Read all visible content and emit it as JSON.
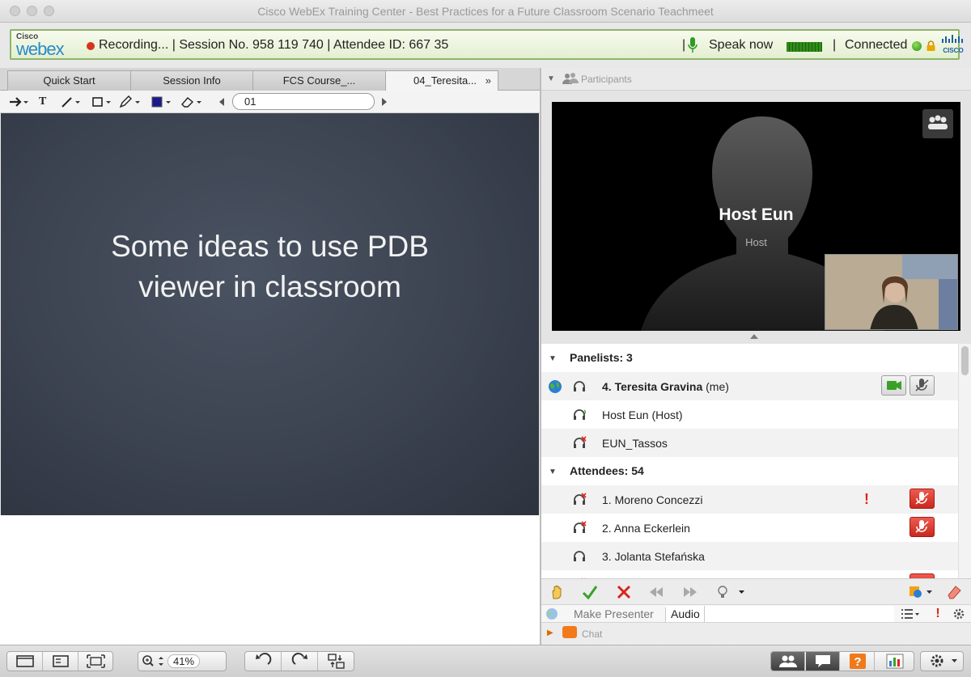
{
  "window": {
    "title": "Cisco WebEx Training Center - Best Practices for a Future Classroom Scenario Teachmeet"
  },
  "banner": {
    "logo_small": "Cisco",
    "logo_large": "webex",
    "status": "Recording... | Session No. 958 119 740 | Attendee ID: 667 35",
    "divider_1": "|",
    "speak": "Speak now",
    "divider_2": "|",
    "connected": "Connected",
    "cisco_text": "CISCO"
  },
  "tabs": [
    {
      "label": "Quick Start"
    },
    {
      "label": "Session Info"
    },
    {
      "label": "FCS Course_..."
    },
    {
      "label": "04_Teresita...",
      "more": "»"
    }
  ],
  "toolbar": {
    "pointer_icon": "arrow-pointer-icon",
    "text_icon": "T",
    "page": "01"
  },
  "slide": {
    "line1": "Some ideas to use PDB",
    "line2": "viewer in classroom"
  },
  "participants_panel": {
    "header": "Participants",
    "video": {
      "name": "Host Eun",
      "role": "Host"
    },
    "panelists": {
      "header": "Panelists: 3",
      "items": [
        {
          "number": "4. Teresita Gravina",
          "suffix": "(me)"
        },
        {
          "name": "Host Eun (Host)"
        },
        {
          "name": "EUN_Tassos"
        }
      ]
    },
    "attendees": {
      "header": "Attendees: 54",
      "items": [
        {
          "name": "1. Moreno Concezzi",
          "flag": "!"
        },
        {
          "name": "2. Anna Eckerlein"
        },
        {
          "name": "3. Jolanta Stefańska"
        }
      ]
    },
    "make_presenter": "Make Presenter",
    "audio": "Audio",
    "alert": "!",
    "chat": "Chat"
  },
  "bottom": {
    "zoom": "41%"
  },
  "colors": {
    "banner_border": "#8fb56a",
    "recording": "#d6341b",
    "connected": "#2f8c1a",
    "mute_red": "#c9281e"
  }
}
